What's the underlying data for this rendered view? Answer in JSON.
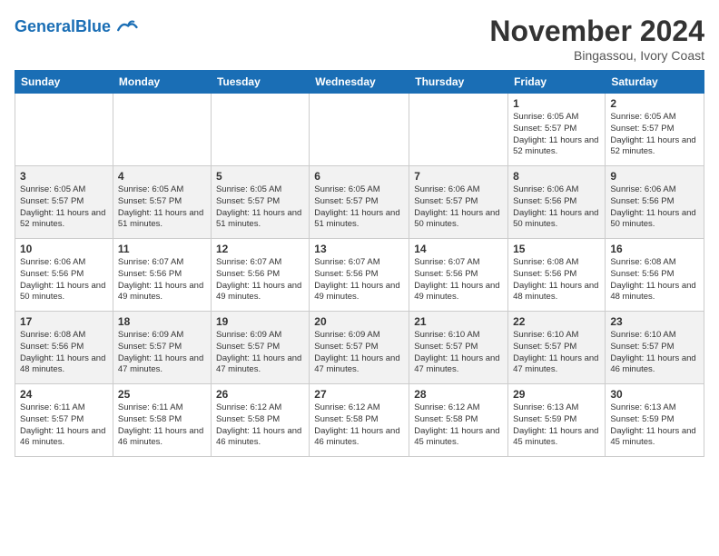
{
  "header": {
    "logo_general": "General",
    "logo_blue": "Blue",
    "month": "November 2024",
    "location": "Bingassou, Ivory Coast"
  },
  "days_of_week": [
    "Sunday",
    "Monday",
    "Tuesday",
    "Wednesday",
    "Thursday",
    "Friday",
    "Saturday"
  ],
  "weeks": [
    [
      {
        "day": "",
        "info": ""
      },
      {
        "day": "",
        "info": ""
      },
      {
        "day": "",
        "info": ""
      },
      {
        "day": "",
        "info": ""
      },
      {
        "day": "",
        "info": ""
      },
      {
        "day": "1",
        "info": "Sunrise: 6:05 AM\nSunset: 5:57 PM\nDaylight: 11 hours\nand 52 minutes."
      },
      {
        "day": "2",
        "info": "Sunrise: 6:05 AM\nSunset: 5:57 PM\nDaylight: 11 hours\nand 52 minutes."
      }
    ],
    [
      {
        "day": "3",
        "info": "Sunrise: 6:05 AM\nSunset: 5:57 PM\nDaylight: 11 hours\nand 52 minutes."
      },
      {
        "day": "4",
        "info": "Sunrise: 6:05 AM\nSunset: 5:57 PM\nDaylight: 11 hours\nand 51 minutes."
      },
      {
        "day": "5",
        "info": "Sunrise: 6:05 AM\nSunset: 5:57 PM\nDaylight: 11 hours\nand 51 minutes."
      },
      {
        "day": "6",
        "info": "Sunrise: 6:05 AM\nSunset: 5:57 PM\nDaylight: 11 hours\nand 51 minutes."
      },
      {
        "day": "7",
        "info": "Sunrise: 6:06 AM\nSunset: 5:57 PM\nDaylight: 11 hours\nand 50 minutes."
      },
      {
        "day": "8",
        "info": "Sunrise: 6:06 AM\nSunset: 5:56 PM\nDaylight: 11 hours\nand 50 minutes."
      },
      {
        "day": "9",
        "info": "Sunrise: 6:06 AM\nSunset: 5:56 PM\nDaylight: 11 hours\nand 50 minutes."
      }
    ],
    [
      {
        "day": "10",
        "info": "Sunrise: 6:06 AM\nSunset: 5:56 PM\nDaylight: 11 hours\nand 50 minutes."
      },
      {
        "day": "11",
        "info": "Sunrise: 6:07 AM\nSunset: 5:56 PM\nDaylight: 11 hours\nand 49 minutes."
      },
      {
        "day": "12",
        "info": "Sunrise: 6:07 AM\nSunset: 5:56 PM\nDaylight: 11 hours\nand 49 minutes."
      },
      {
        "day": "13",
        "info": "Sunrise: 6:07 AM\nSunset: 5:56 PM\nDaylight: 11 hours\nand 49 minutes."
      },
      {
        "day": "14",
        "info": "Sunrise: 6:07 AM\nSunset: 5:56 PM\nDaylight: 11 hours\nand 49 minutes."
      },
      {
        "day": "15",
        "info": "Sunrise: 6:08 AM\nSunset: 5:56 PM\nDaylight: 11 hours\nand 48 minutes."
      },
      {
        "day": "16",
        "info": "Sunrise: 6:08 AM\nSunset: 5:56 PM\nDaylight: 11 hours\nand 48 minutes."
      }
    ],
    [
      {
        "day": "17",
        "info": "Sunrise: 6:08 AM\nSunset: 5:56 PM\nDaylight: 11 hours\nand 48 minutes."
      },
      {
        "day": "18",
        "info": "Sunrise: 6:09 AM\nSunset: 5:57 PM\nDaylight: 11 hours\nand 47 minutes."
      },
      {
        "day": "19",
        "info": "Sunrise: 6:09 AM\nSunset: 5:57 PM\nDaylight: 11 hours\nand 47 minutes."
      },
      {
        "day": "20",
        "info": "Sunrise: 6:09 AM\nSunset: 5:57 PM\nDaylight: 11 hours\nand 47 minutes."
      },
      {
        "day": "21",
        "info": "Sunrise: 6:10 AM\nSunset: 5:57 PM\nDaylight: 11 hours\nand 47 minutes."
      },
      {
        "day": "22",
        "info": "Sunrise: 6:10 AM\nSunset: 5:57 PM\nDaylight: 11 hours\nand 47 minutes."
      },
      {
        "day": "23",
        "info": "Sunrise: 6:10 AM\nSunset: 5:57 PM\nDaylight: 11 hours\nand 46 minutes."
      }
    ],
    [
      {
        "day": "24",
        "info": "Sunrise: 6:11 AM\nSunset: 5:57 PM\nDaylight: 11 hours\nand 46 minutes."
      },
      {
        "day": "25",
        "info": "Sunrise: 6:11 AM\nSunset: 5:58 PM\nDaylight: 11 hours\nand 46 minutes."
      },
      {
        "day": "26",
        "info": "Sunrise: 6:12 AM\nSunset: 5:58 PM\nDaylight: 11 hours\nand 46 minutes."
      },
      {
        "day": "27",
        "info": "Sunrise: 6:12 AM\nSunset: 5:58 PM\nDaylight: 11 hours\nand 46 minutes."
      },
      {
        "day": "28",
        "info": "Sunrise: 6:12 AM\nSunset: 5:58 PM\nDaylight: 11 hours\nand 45 minutes."
      },
      {
        "day": "29",
        "info": "Sunrise: 6:13 AM\nSunset: 5:59 PM\nDaylight: 11 hours\nand 45 minutes."
      },
      {
        "day": "30",
        "info": "Sunrise: 6:13 AM\nSunset: 5:59 PM\nDaylight: 11 hours\nand 45 minutes."
      }
    ]
  ]
}
